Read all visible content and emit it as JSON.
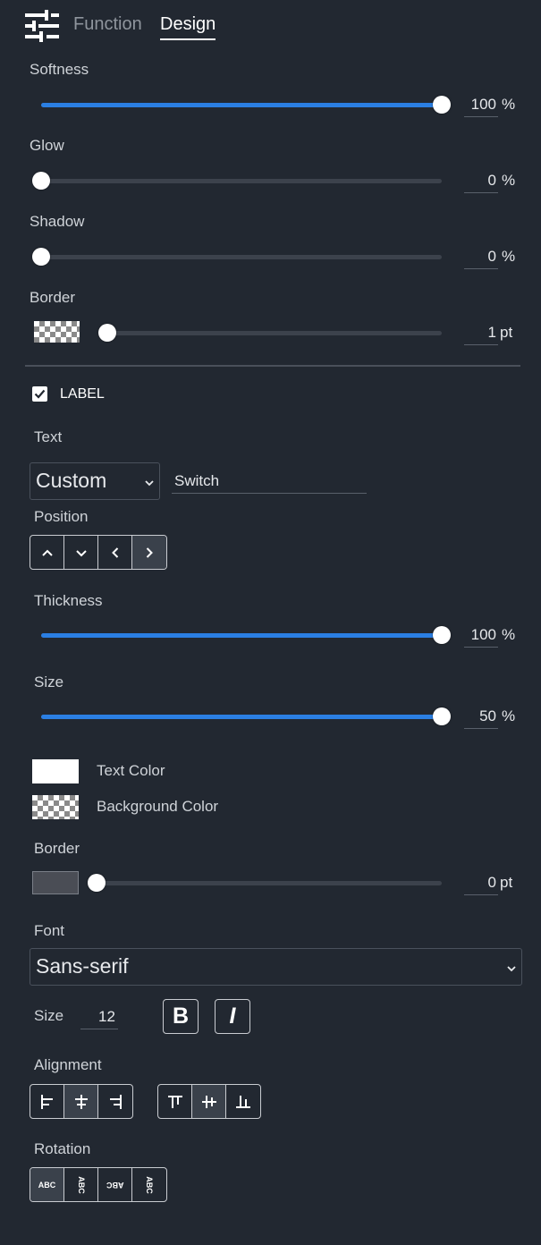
{
  "header": {
    "tabs": [
      {
        "label": "Function"
      },
      {
        "label": "Design"
      }
    ],
    "active_tab": "Design"
  },
  "shape": {
    "softness": {
      "label": "Softness",
      "value": "100",
      "unit": "%",
      "fraction": 1.0
    },
    "glow": {
      "label": "Glow",
      "value": "0",
      "unit": "%",
      "fraction": 0.0
    },
    "shadow": {
      "label": "Shadow",
      "value": "0",
      "unit": "%",
      "fraction": 0.0
    },
    "border": {
      "label": "Border",
      "value": "1",
      "unit": "pt",
      "fraction": 0.0
    }
  },
  "label_section": {
    "checkbox_label": "LABEL",
    "checked": true,
    "text_label": "Text",
    "text_mode": "Custom",
    "text_value": "Switch",
    "position_label": "Position",
    "thickness": {
      "label": "Thickness",
      "value": "100",
      "unit": "%",
      "fraction": 1.0
    },
    "size": {
      "label": "Size",
      "value": "50",
      "unit": "%",
      "fraction": 1.0
    },
    "text_color_label": "Text Color",
    "text_color": "#ffffff",
    "background_color_label": "Background Color",
    "border": {
      "label": "Border",
      "value": "0",
      "unit": "pt",
      "fraction": 0.0,
      "color": "#4a4d55"
    },
    "font_label": "Font",
    "font_value": "Sans-serif",
    "font_size_label": "Size",
    "font_size_value": "12",
    "bold_glyph": "B",
    "italic_glyph": "I",
    "alignment_label": "Alignment",
    "rotation_label": "Rotation",
    "rotation_options": [
      "ABC",
      "ABC",
      "ABC",
      "ABC"
    ]
  },
  "colors": {
    "accent": "#2b7fe3",
    "background": "#222831"
  }
}
